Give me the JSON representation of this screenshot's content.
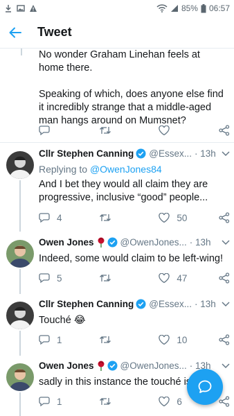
{
  "status_bar": {
    "battery": "85%",
    "time": "06:57"
  },
  "header": {
    "title": "Tweet"
  },
  "partial_tweet": {
    "text": "No wonder Graham Linehan feels at home there.\n\nSpeaking of which, does anyone else find it incredibly strange that a middle-aged man hangs around on Mumsnet?"
  },
  "replies": [
    {
      "name": "Cllr Stephen Canning",
      "handle": "@Essex...",
      "time": "· 13h",
      "replying_prefix": "Replying to ",
      "replying_handle": "@OwenJones84",
      "text_line1": "And I bet they would all claim they are",
      "text_line2": "progressive, inclusive “good” people...",
      "reply_count": "4",
      "retweet_count": "",
      "like_count": "50"
    },
    {
      "name": "Owen Jones",
      "handle": "@OwenJones...",
      "time": "· 13h",
      "text_line1": "Indeed, some would claim to be left-wing!",
      "reply_count": "5",
      "retweet_count": "",
      "like_count": "47"
    },
    {
      "name": "Cllr Stephen Canning",
      "handle": "@Essex...",
      "time": "· 13h",
      "text_line1": "Touché 😂",
      "reply_count": "1",
      "retweet_count": "",
      "like_count": "10"
    },
    {
      "name": "Owen Jones",
      "handle": "@OwenJones...",
      "time": "· 13h",
      "text_line1": "sadly in this instance the touché is on",
      "reply_count": "1",
      "retweet_count": "",
      "like_count": "6"
    }
  ],
  "colors": {
    "accent": "#1da1f2",
    "muted": "#657786",
    "rose": "#c8102e"
  }
}
